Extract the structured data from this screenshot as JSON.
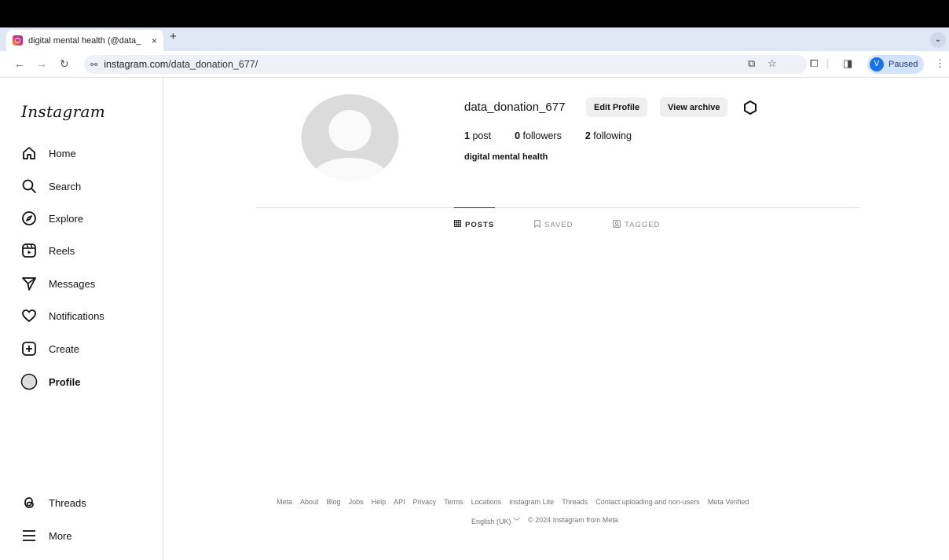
{
  "browser": {
    "tab_title": "digital mental health (@data_",
    "tab_close": "×",
    "new_tab": "+",
    "tab_menu": "⌄",
    "url_host": "instagram.com",
    "url_path": "/data_donation_677/",
    "profile_initial": "V",
    "profile_status": "Paused"
  },
  "sidebar": {
    "logo": "Instagram",
    "items": [
      {
        "label": "Home",
        "icon": "home-icon"
      },
      {
        "label": "Search",
        "icon": "search-icon"
      },
      {
        "label": "Explore",
        "icon": "compass-icon"
      },
      {
        "label": "Reels",
        "icon": "reels-icon"
      },
      {
        "label": "Messages",
        "icon": "send-icon"
      },
      {
        "label": "Notifications",
        "icon": "heart-icon"
      },
      {
        "label": "Create",
        "icon": "plus-square-icon"
      },
      {
        "label": "Profile",
        "icon": "avatar-icon"
      }
    ],
    "bottom_items": [
      {
        "label": "Threads",
        "icon": "threads-icon"
      },
      {
        "label": "More",
        "icon": "menu-icon"
      }
    ]
  },
  "profile": {
    "username": "data_donation_677",
    "edit_button": "Edit Profile",
    "archive_button": "View archive",
    "posts_count": "1",
    "posts_label": "post",
    "followers_count": "0",
    "followers_label": "followers",
    "following_count": "2",
    "following_label": "following",
    "bio_name": "digital mental health"
  },
  "tabs": {
    "posts": "POSTS",
    "saved": "SAVED",
    "tagged": "TAGGED"
  },
  "footer": {
    "links": [
      "Meta",
      "About",
      "Blog",
      "Jobs",
      "Help",
      "API",
      "Privacy",
      "Terms",
      "Locations",
      "Instagram Lite",
      "Threads",
      "Contact uploading and non-users",
      "Meta Verified"
    ],
    "language": "English (UK)",
    "copyright": "© 2024 Instagram from Meta"
  }
}
